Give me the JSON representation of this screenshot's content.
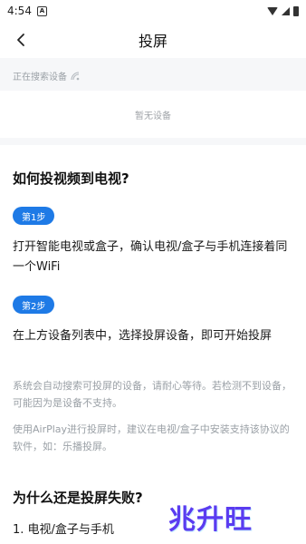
{
  "status_bar": {
    "time": "4:54",
    "app_icon_letter": "A"
  },
  "header": {
    "title": "投屏"
  },
  "search": {
    "status": "正在搜索设备",
    "empty": "暂无设备"
  },
  "help": {
    "title": "如何投视频到电视?",
    "steps": [
      {
        "badge": "第1步",
        "text": "打开智能电视或盒子，确认电视/盒子与手机连接着同一个WiFi"
      },
      {
        "badge": "第2步",
        "text": "在上方设备列表中，选择投屏设备，即可开始投屏"
      }
    ],
    "notes": [
      "系统会自动搜索可投屏的设备，请耐心等待。若检测不到设备，可能因为是设备不支持。",
      "使用AirPlay进行投屏时，建议在电视/盒子中安装支持该协议的软件，如：乐播投屏。"
    ],
    "faq_title": "为什么还是投屏失败?",
    "faq_item1": "1. 电视/盒子与手机"
  },
  "watermark": "兆升旺",
  "colors": {
    "accent": "#1e7ae6",
    "bg_gray": "#f6f7f9",
    "muted": "#9aa0a6"
  }
}
